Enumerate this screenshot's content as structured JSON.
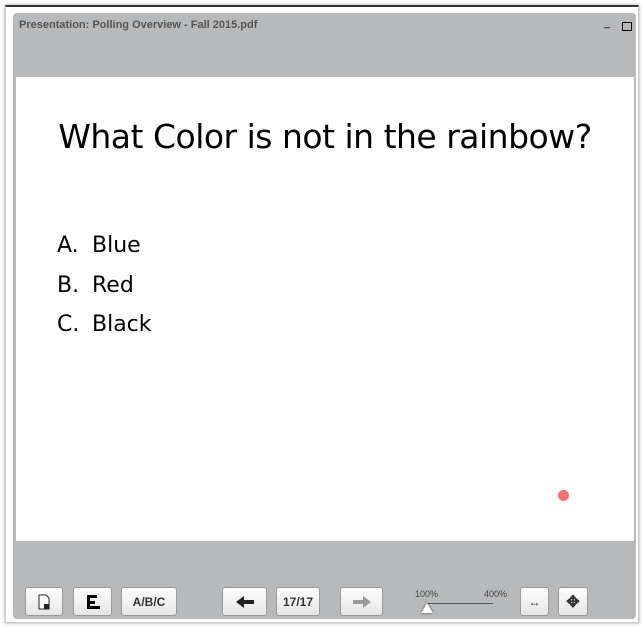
{
  "window": {
    "title": "Presentation: Polling Overview - Fall 2015.pdf",
    "minimize": "_"
  },
  "slide": {
    "question": "What Color is not in the rainbow?",
    "options": [
      {
        "letter": "A.",
        "text": "Blue"
      },
      {
        "letter": "B.",
        "text": "Red"
      },
      {
        "letter": "C.",
        "text": "Black"
      }
    ],
    "pointer_color": "#f87171"
  },
  "toolbar": {
    "abc_label": "A/B/C",
    "page": "17/17",
    "zoom_min": "100%",
    "zoom_max": "400%",
    "zoom_level_percent": 100,
    "fit_width": "↔",
    "pan": "✥"
  }
}
